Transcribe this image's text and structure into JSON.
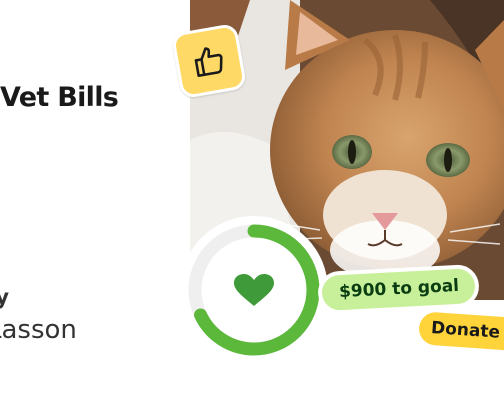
{
  "campaign": {
    "title": "Vet Bills"
  },
  "organizer": {
    "label": "Organized by",
    "name": "Lasson"
  },
  "photo": {
    "subject": "cat-photo"
  },
  "badges": {
    "thumbs_icon": "thumbs-up-icon",
    "heart_icon": "heart-icon"
  },
  "progress": {
    "fraction": 0.68,
    "goal_text": "$900 to goal"
  },
  "actions": {
    "donate_label": "Donate"
  },
  "colors": {
    "ring_green": "#5cb83a",
    "ring_track": "#efefef",
    "heart_green": "#3f9a3a",
    "goal_pill": "#c8f09a",
    "donate_pill": "#ffd43b",
    "badge_yellow": "#ffd966"
  }
}
